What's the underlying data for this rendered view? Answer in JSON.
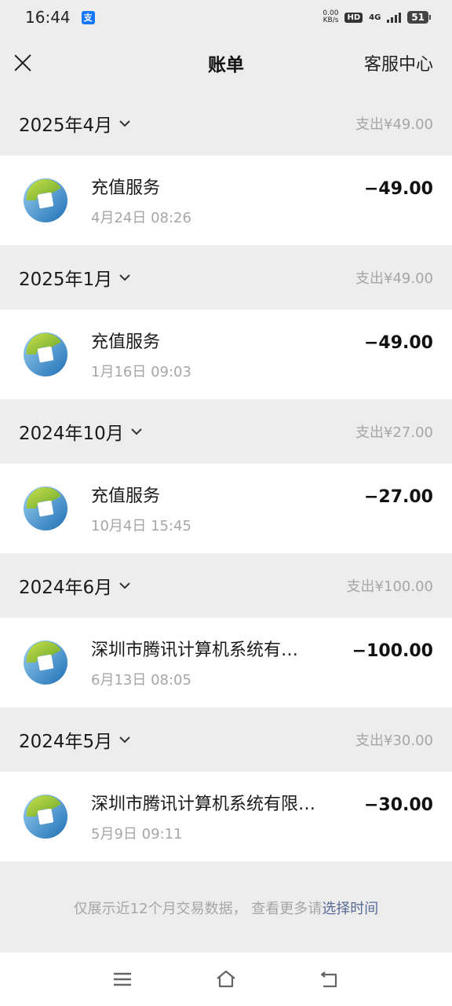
{
  "status": {
    "time": "16:44",
    "app_badge": "支",
    "net_speed_value": "0.00",
    "net_speed_unit": "KB/s",
    "hd": "HD",
    "network": "4G",
    "battery": "51"
  },
  "nav": {
    "title": "账单",
    "service": "客服中心"
  },
  "months": [
    {
      "label": "2025年4月",
      "total": "支出¥49.00",
      "txn": {
        "name": "充值服务",
        "time": "4月24日 08:26",
        "amount": "−49.00"
      }
    },
    {
      "label": "2025年1月",
      "total": "支出¥49.00",
      "txn": {
        "name": "充值服务",
        "time": "1月16日 09:03",
        "amount": "−49.00"
      }
    },
    {
      "label": "2024年10月",
      "total": "支出¥27.00",
      "txn": {
        "name": "充值服务",
        "time": "10月4日 15:45",
        "amount": "−27.00"
      }
    },
    {
      "label": "2024年6月",
      "total": "支出¥100.00",
      "txn": {
        "name": "深圳市腾讯计算机系统有…",
        "time": "6月13日 08:05",
        "amount": "−100.00"
      }
    },
    {
      "label": "2024年5月",
      "total": "支出¥30.00",
      "txn": {
        "name": "深圳市腾讯计算机系统有限…",
        "time": "5月9日 09:11",
        "amount": "−30.00"
      }
    }
  ],
  "footer": {
    "note": "仅展示近12个月交易数据， 查看更多请",
    "link": "选择时间"
  },
  "icons": {
    "close": "close-icon",
    "chevron": "chevron-down-icon",
    "logo": "qq-recharge-logo-icon",
    "menu": "menu-icon",
    "home": "home-icon",
    "back": "back-icon"
  }
}
